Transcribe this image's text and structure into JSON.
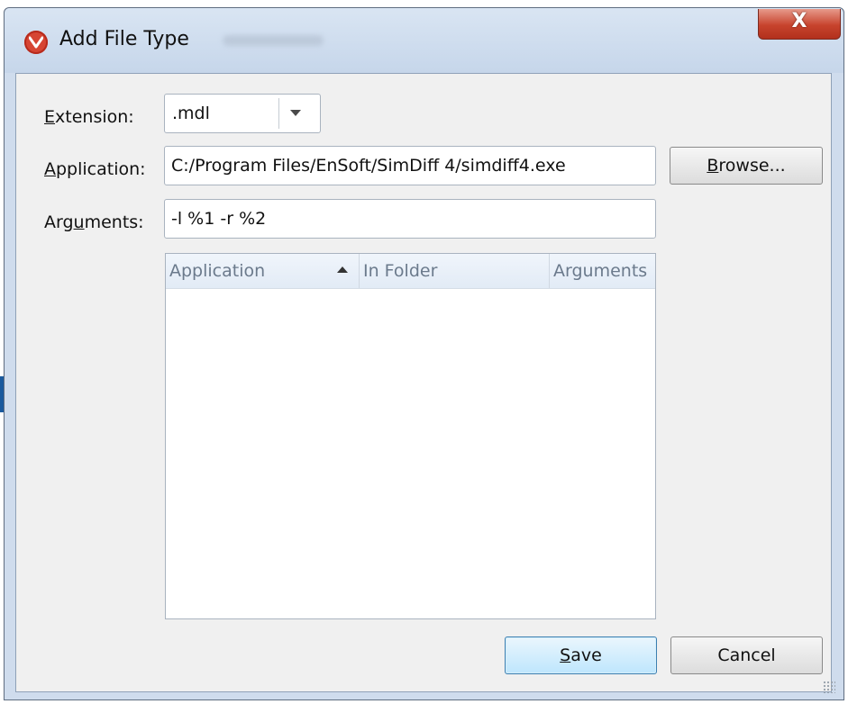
{
  "window": {
    "title": "Add File Type",
    "close_label": "X"
  },
  "form": {
    "extension_label_prefix": "E",
    "extension_label_rest": "xtension:",
    "extension_value": ".mdl",
    "application_label_prefix": "A",
    "application_label_rest": "pplication:",
    "application_value": "C:/Program Files/EnSoft/SimDiff 4/simdiff4.exe",
    "arguments_label_before": "Arg",
    "arguments_label_key": "u",
    "arguments_label_after": "ments:",
    "arguments_value": "-l %1 -r %2"
  },
  "browse_button": {
    "label_key": "B",
    "label_rest": "rowse..."
  },
  "table": {
    "columns": [
      "Application",
      "In Folder",
      "Arguments"
    ],
    "sort_column": "Application",
    "sort_direction": "ascending",
    "rows": []
  },
  "footer": {
    "save_key": "S",
    "save_rest": "ave",
    "cancel_label": "Cancel"
  }
}
